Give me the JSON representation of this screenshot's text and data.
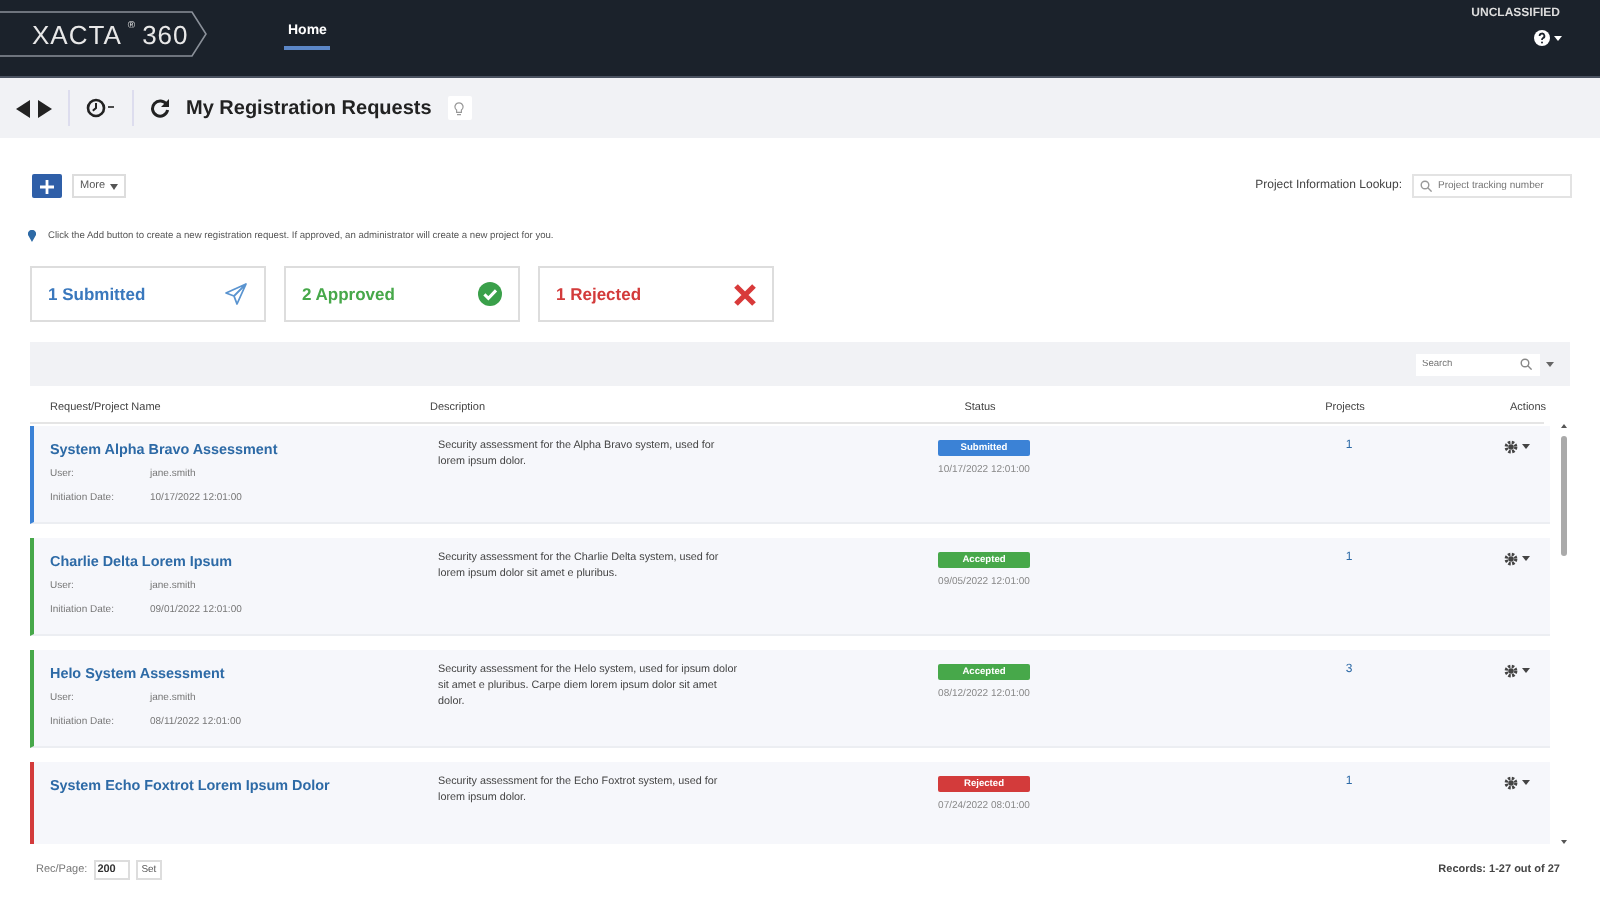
{
  "header": {
    "logo": "XACTA",
    "logo_mark": "®",
    "logo_number": "360",
    "nav": [
      {
        "label": "Home",
        "selected": true
      }
    ],
    "classification": "UNCLASSIFIED"
  },
  "toolbar": {
    "title": "My Registration Requests"
  },
  "actions": {
    "more_label": "More",
    "lookup_label": "Project Information Lookup:",
    "lookup_placeholder": "Project tracking number"
  },
  "info": "Click the Add button to create a new registration request. If approved, an administrator will create a new project for you.",
  "summary": [
    {
      "kind": "submitted",
      "label": "1 Submitted"
    },
    {
      "kind": "approved",
      "label": "2 Approved"
    },
    {
      "kind": "rejected",
      "label": "1 Rejected"
    }
  ],
  "table": {
    "search_placeholder": "Search",
    "columns": [
      "Request/Project Name",
      "Description",
      "Status",
      "Projects",
      "Actions"
    ],
    "rows": [
      {
        "name": "System Alpha Bravo Assessment",
        "user_label": "User:",
        "user": "jane.smith",
        "date_label": "Initiation Date:",
        "date": "10/17/2022 12:01:00",
        "description": "Security assessment for the Alpha Bravo system, used for lorem ipsum dolor.",
        "status": "Submitted",
        "color": "#3b82d6",
        "status_date": "10/17/2022 12:01:00",
        "projects": "1"
      },
      {
        "name": "Charlie Delta Lorem Ipsum",
        "user_label": "User:",
        "user": "jane.smith",
        "date_label": "Initiation Date:",
        "date": "09/01/2022 12:01:00",
        "description": "Security assessment for the Charlie Delta system, used for lorem ipsum dolor sit amet e pluribus.",
        "status": "Accepted",
        "color": "#47a84a",
        "status_date": "09/05/2022 12:01:00",
        "projects": "1"
      },
      {
        "name": "Helo System Assessment",
        "user_label": "User:",
        "user": "jane.smith",
        "date_label": "Initiation Date:",
        "date": "08/11/2022 12:01:00",
        "description": "Security assessment for the Helo system, used for ipsum dolor sit amet e pluribus. Carpe diem lorem ipsum dolor sit amet dolor.",
        "status": "Accepted",
        "color": "#47a84a",
        "status_date": "08/12/2022 12:01:00",
        "projects": "3"
      },
      {
        "name": "System Echo Foxtrot Lorem Ipsum Dolor",
        "description": "Security assessment for the Echo Foxtrot system, used for lorem ipsum dolor.",
        "status": "Rejected",
        "color": "#d33b3b",
        "status_date": "07/24/2022 08:01:00",
        "projects": "1"
      }
    ]
  },
  "footer": {
    "rec_label": "Rec/Page:",
    "rec_value": "200",
    "set_label": "Set",
    "records": "Records: 1-27 out of 27"
  }
}
